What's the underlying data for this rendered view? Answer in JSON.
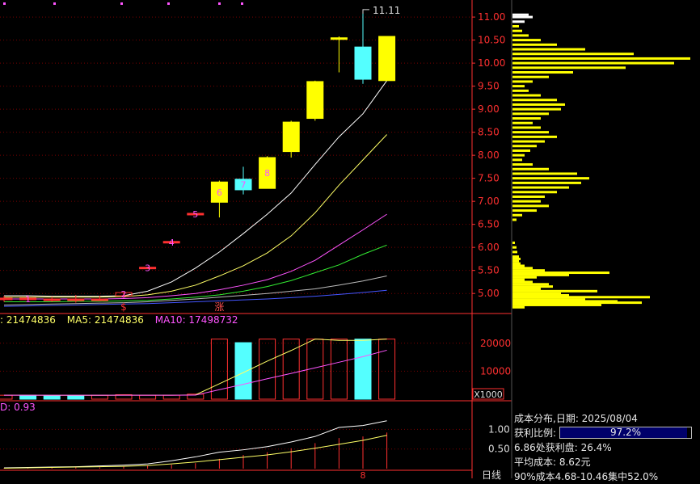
{
  "chart_data": [
    {
      "type": "candlestick",
      "price_axis": {
        "ticks": [
          "11.00",
          "10.50",
          "10.00",
          "9.50",
          "9.00",
          "8.50",
          "8.00",
          "7.50",
          "7.00",
          "6.50",
          "6.00",
          "5.50",
          "5.00"
        ],
        "range": [
          4.6,
          11.3
        ]
      },
      "candles": [
        {
          "o": 4.9,
          "h": 4.95,
          "l": 4.82,
          "c": 4.9,
          "color": "#ff3030"
        },
        {
          "o": 4.9,
          "h": 4.95,
          "l": 4.85,
          "c": 4.9,
          "color": "#ff3030"
        },
        {
          "o": 4.88,
          "h": 4.93,
          "l": 4.82,
          "c": 4.88,
          "color": "#ff3030"
        },
        {
          "o": 4.88,
          "h": 4.97,
          "l": 4.8,
          "c": 4.88,
          "color": "#ff3030"
        },
        {
          "o": 4.88,
          "h": 4.95,
          "l": 4.85,
          "c": 4.88,
          "color": "#ff3030"
        },
        {
          "o": 4.95,
          "h": 5.02,
          "l": 4.9,
          "c": 5.02,
          "color": "#ff3030"
        },
        {
          "o": 5.57,
          "h": 5.57,
          "l": 5.57,
          "c": 5.57,
          "color": "#ff3030"
        },
        {
          "o": 6.13,
          "h": 6.13,
          "l": 6.13,
          "c": 6.13,
          "color": "#ff3030"
        },
        {
          "o": 6.74,
          "h": 6.74,
          "l": 6.74,
          "c": 6.74,
          "color": "#ff3030"
        },
        {
          "o": 6.98,
          "h": 7.45,
          "l": 6.65,
          "c": 7.42,
          "color": "#ffff00"
        },
        {
          "o": 7.48,
          "h": 7.75,
          "l": 7.15,
          "c": 7.25,
          "color": "#54ffff"
        },
        {
          "o": 7.28,
          "h": 7.98,
          "l": 7.28,
          "c": 7.95,
          "color": "#ffff00"
        },
        {
          "o": 8.08,
          "h": 8.75,
          "l": 7.95,
          "c": 8.72,
          "color": "#ffff00"
        },
        {
          "o": 8.8,
          "h": 9.62,
          "l": 8.75,
          "c": 9.6,
          "color": "#ffff00"
        },
        {
          "o": 10.55,
          "h": 10.58,
          "l": 9.8,
          "c": 10.52,
          "color": "#ffff00"
        },
        {
          "o": 10.35,
          "h": 11.11,
          "l": 9.55,
          "c": 9.65,
          "color": "#54ffff"
        },
        {
          "o": 9.62,
          "h": 10.58,
          "l": 9.62,
          "c": 10.58,
          "color": "#ffff00"
        }
      ],
      "candle_labels": [
        "",
        "1",
        "",
        "",
        "",
        "2",
        "3",
        "4",
        "5",
        "6",
        "7",
        "8",
        "",
        "",
        "",
        "",
        ""
      ],
      "high_label": "11.11",
      "markers": [
        {
          "index": 5,
          "text": "$",
          "color": "#ff3030"
        },
        {
          "index": 9,
          "text": "涨",
          "color": "#ff5050"
        }
      ],
      "ma_series": [
        {
          "color": "#ffffff",
          "values": [
            4.95,
            4.95,
            4.94,
            4.94,
            4.94,
            4.95,
            5.05,
            5.25,
            5.55,
            5.9,
            6.3,
            6.72,
            7.18,
            7.8,
            8.4,
            8.9,
            9.62
          ]
        },
        {
          "color": "#ffff66",
          "values": [
            4.92,
            4.92,
            4.92,
            4.92,
            4.92,
            4.93,
            4.97,
            5.05,
            5.18,
            5.38,
            5.6,
            5.88,
            6.25,
            6.75,
            7.35,
            7.9,
            8.45
          ]
        },
        {
          "color": "#ff55ff",
          "values": [
            4.88,
            4.88,
            4.88,
            4.88,
            4.88,
            4.89,
            4.91,
            4.95,
            5.0,
            5.08,
            5.18,
            5.3,
            5.48,
            5.72,
            6.05,
            6.38,
            6.72
          ]
        },
        {
          "color": "#33ee33",
          "values": [
            4.82,
            4.82,
            4.82,
            4.83,
            4.83,
            4.84,
            4.85,
            4.88,
            4.92,
            4.97,
            5.05,
            5.15,
            5.28,
            5.45,
            5.62,
            5.85,
            6.05
          ]
        },
        {
          "color": "#bbbbbb",
          "values": [
            4.75,
            4.76,
            4.77,
            4.78,
            4.79,
            4.8,
            4.82,
            4.85,
            4.88,
            4.92,
            4.96,
            5.0,
            5.05,
            5.1,
            5.18,
            5.27,
            5.38
          ]
        },
        {
          "color": "#4455ff",
          "values": [
            4.72,
            4.73,
            4.74,
            4.75,
            4.76,
            4.77,
            4.78,
            4.8,
            4.82,
            4.84,
            4.86,
            4.88,
            4.91,
            4.94,
            4.98,
            5.02,
            5.07
          ]
        }
      ]
    },
    {
      "type": "bar",
      "unit_label": "X1000",
      "ticks": [
        "20000",
        "10000"
      ],
      "range": [
        0,
        26000
      ],
      "values": [
        1400,
        1400,
        1300,
        1300,
        1400,
        1600,
        1400,
        1400,
        1800,
        21474,
        20200,
        21474,
        21474,
        21474,
        21474,
        21474,
        21474
      ],
      "colors": [
        "#ff3030",
        "#54ffff",
        "#54ffff",
        "#54ffff",
        "#ff3030",
        "#ff3030",
        "#ff3030",
        "#ff3030",
        "#ff3030",
        "#ff3030",
        "#54ffff",
        "#ff3030",
        "#ff3030",
        "#ff3030",
        "#ff3030",
        "#54ffff",
        "#ff3030"
      ],
      "ma5": [
        1400,
        1400,
        1380,
        1360,
        1360,
        1400,
        1400,
        1420,
        1520,
        5500,
        9500,
        13600,
        17400,
        21474,
        21000,
        21000,
        21474
      ],
      "ma10": [
        1400,
        1400,
        1400,
        1400,
        1400,
        1400,
        1400,
        1400,
        1430,
        3400,
        5300,
        7300,
        9200,
        11200,
        13200,
        15200,
        17498
      ]
    },
    {
      "type": "line",
      "ticks": [
        "1.00",
        "0.50"
      ],
      "range": [
        0,
        1.4
      ],
      "line1": [
        0.02,
        0.03,
        0.04,
        0.05,
        0.07,
        0.09,
        0.12,
        0.2,
        0.3,
        0.42,
        0.48,
        0.56,
        0.68,
        0.82,
        1.05,
        1.1,
        1.22
      ],
      "line2": [
        0.01,
        0.02,
        0.03,
        0.04,
        0.05,
        0.06,
        0.08,
        0.12,
        0.17,
        0.23,
        0.29,
        0.35,
        0.43,
        0.52,
        0.62,
        0.72,
        0.85
      ],
      "bars": [
        0.02,
        0.02,
        0.02,
        0.03,
        0.03,
        0.05,
        0.08,
        0.1,
        0.14,
        0.25,
        0.35,
        0.42,
        0.52,
        0.65,
        0.78,
        0.82,
        0.92
      ],
      "bottom_marker": "8"
    }
  ],
  "volume_legend": {
    "vol": ": 21474836",
    "ma5": "MA5: 21474836",
    "ma10": "MA10: 17498732",
    "colors": {
      "vol": "#ffff66",
      "ma5": "#ffff66",
      "ma10": "#ff55ff"
    }
  },
  "indicator_legend": "D: 0.93",
  "cost_distribution": {
    "title": "成本分布,日期: 2025/08/04",
    "profit_label": "获利比例:",
    "profit_ratio_text": "97.2%",
    "profit_ratio": 0.972,
    "profit_line": "6.86处获利盘: 26.4%",
    "avg_cost": "平均成本: 8.62元",
    "conc_line": "90%成本4.68-10.46集中52.0%",
    "profile": [
      {
        "p": 4.7,
        "w": 15
      },
      {
        "p": 4.75,
        "w": 110
      },
      {
        "p": 4.8,
        "w": 160
      },
      {
        "p": 4.83,
        "w": 130
      },
      {
        "p": 4.87,
        "w": 90
      },
      {
        "p": 4.92,
        "w": 170
      },
      {
        "p": 4.96,
        "w": 70
      },
      {
        "p": 5.0,
        "w": 60
      },
      {
        "p": 5.05,
        "w": 105
      },
      {
        "p": 5.1,
        "w": 35
      },
      {
        "p": 5.15,
        "w": 50
      },
      {
        "p": 5.2,
        "w": 45
      },
      {
        "p": 5.25,
        "w": 25
      },
      {
        "p": 5.3,
        "w": 15
      },
      {
        "p": 5.35,
        "w": 30
      },
      {
        "p": 5.4,
        "w": 70
      },
      {
        "p": 5.45,
        "w": 120
      },
      {
        "p": 5.5,
        "w": 40
      },
      {
        "p": 5.55,
        "w": 25
      },
      {
        "p": 5.6,
        "w": 15
      },
      {
        "p": 5.65,
        "w": 10
      },
      {
        "p": 5.7,
        "w": 8
      },
      {
        "p": 5.75,
        "w": 10
      },
      {
        "p": 5.8,
        "w": 8
      },
      {
        "p": 5.9,
        "w": 6
      },
      {
        "p": 6.0,
        "w": 5
      },
      {
        "p": 6.1,
        "w": 3
      },
      {
        "p": 6.6,
        "w": 5
      },
      {
        "p": 6.7,
        "w": 12
      },
      {
        "p": 6.8,
        "w": 30
      },
      {
        "p": 6.9,
        "w": 45
      },
      {
        "p": 7.0,
        "w": 35
      },
      {
        "p": 7.1,
        "w": 40
      },
      {
        "p": 7.2,
        "w": 55
      },
      {
        "p": 7.3,
        "w": 70
      },
      {
        "p": 7.4,
        "w": 85
      },
      {
        "p": 7.5,
        "w": 95
      },
      {
        "p": 7.6,
        "w": 80
      },
      {
        "p": 7.7,
        "w": 45
      },
      {
        "p": 7.8,
        "w": 25
      },
      {
        "p": 7.9,
        "w": 12
      },
      {
        "p": 8.0,
        "w": 15
      },
      {
        "p": 8.1,
        "w": 22
      },
      {
        "p": 8.2,
        "w": 30
      },
      {
        "p": 8.3,
        "w": 40
      },
      {
        "p": 8.4,
        "w": 55
      },
      {
        "p": 8.5,
        "w": 45
      },
      {
        "p": 8.6,
        "w": 35
      },
      {
        "p": 8.7,
        "w": 25
      },
      {
        "p": 8.8,
        "w": 35
      },
      {
        "p": 8.9,
        "w": 45
      },
      {
        "p": 9.0,
        "w": 60
      },
      {
        "p": 9.1,
        "w": 65
      },
      {
        "p": 9.2,
        "w": 55
      },
      {
        "p": 9.3,
        "w": 35
      },
      {
        "p": 9.4,
        "w": 20
      },
      {
        "p": 9.5,
        "w": 15
      },
      {
        "p": 9.6,
        "w": 25
      },
      {
        "p": 9.7,
        "w": 45
      },
      {
        "p": 9.8,
        "w": 75
      },
      {
        "p": 9.9,
        "w": 140
      },
      {
        "p": 10.0,
        "w": 200
      },
      {
        "p": 10.1,
        "w": 220
      },
      {
        "p": 10.2,
        "w": 150
      },
      {
        "p": 10.3,
        "w": 90
      },
      {
        "p": 10.4,
        "w": 55
      },
      {
        "p": 10.5,
        "w": 35
      },
      {
        "p": 10.6,
        "w": 20
      },
      {
        "p": 10.7,
        "w": 12
      },
      {
        "p": 10.8,
        "w": 8
      },
      {
        "p": 10.9,
        "w": 15
      },
      {
        "p": 11.0,
        "w": 25
      },
      {
        "p": 11.05,
        "w": 20
      }
    ]
  },
  "period_tab": "日线"
}
